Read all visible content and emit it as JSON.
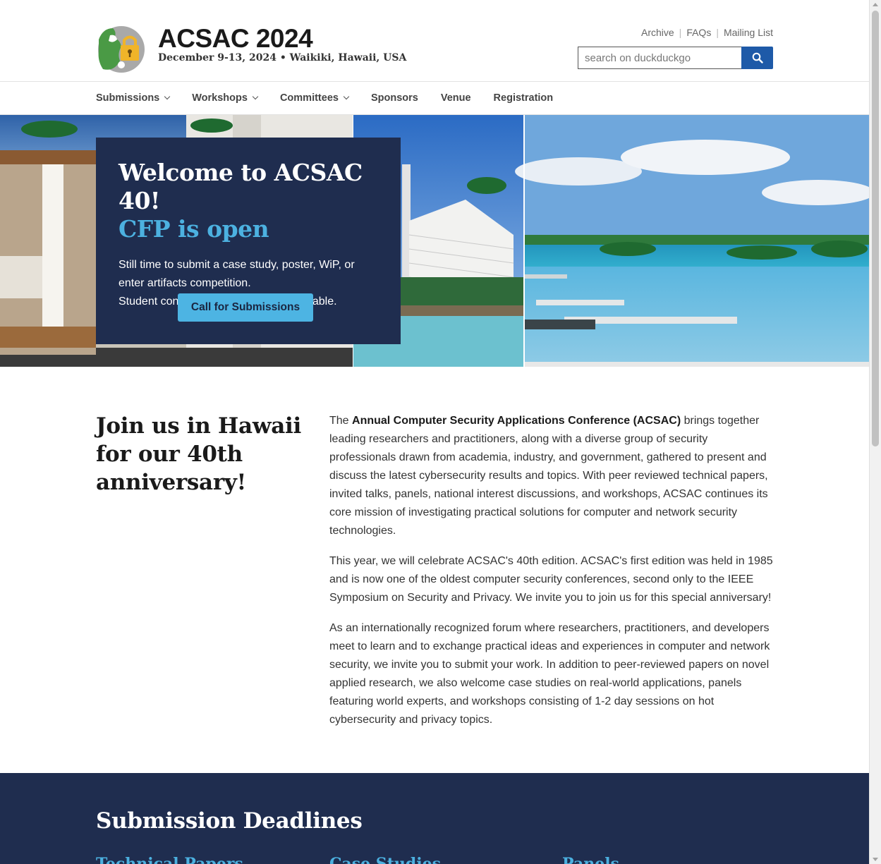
{
  "header": {
    "title": "ACSAC 2024",
    "subtitle": "December 9-13, 2024 • Waikiki, Hawaii, USA",
    "util_links": [
      "Archive",
      "FAQs",
      "Mailing List"
    ],
    "search_placeholder": "search on duckduckgo"
  },
  "nav": {
    "items": [
      {
        "label": "Submissions",
        "dropdown": true
      },
      {
        "label": "Workshops",
        "dropdown": true
      },
      {
        "label": "Committees",
        "dropdown": true
      },
      {
        "label": "Sponsors",
        "dropdown": false
      },
      {
        "label": "Venue",
        "dropdown": false
      },
      {
        "label": "Registration",
        "dropdown": false
      }
    ]
  },
  "hero": {
    "title": "Welcome to ACSAC 40!",
    "title2": "CFP is open",
    "text_line1": "Still time to submit a case study, poster, WiP, or enter artifacts competition.",
    "text_line2": "Student conferenceships are also available.",
    "button": "Call for Submissions"
  },
  "intro": {
    "heading": "Join us in Hawaii for our 40th anniversary!",
    "p1_pre": "The ",
    "p1_strong": "Annual Computer Security Applications Conference (ACSAC)",
    "p1_post": " brings together leading researchers and practitioners, along with a diverse group of security professionals drawn from academia, industry, and government, gathered to present and discuss the latest cybersecurity results and topics. With peer reviewed technical papers, invited talks, panels, national interest discussions, and workshops, ACSAC continues its core mission of investigating practical solutions for computer and network security technologies.",
    "p2": "This year, we will celebrate ACSAC's 40th edition. ACSAC's first edition was held in 1985 and is now one of the oldest computer security conferences, second only to the IEEE Symposium on Security and Privacy. We invite you to join us for this special anniversary!",
    "p3": "As an internationally recognized forum where researchers, practitioners, and developers meet to learn and to exchange practical ideas and experiences in computer and network security, we invite you to submit your work. In addition to peer-reviewed papers on novel applied research, we also welcome case studies on real-world applications, panels featuring world experts, and workshops consisting of 1-2 day sessions on hot cybersecurity and privacy topics."
  },
  "deadlines": {
    "heading": "Submission Deadlines",
    "columns": [
      "Technical Papers",
      "Case Studies",
      "Panels"
    ]
  },
  "colors": {
    "navy": "#1f2d4f",
    "accent_blue": "#4cb1e0",
    "search_button": "#1e5aa8"
  }
}
